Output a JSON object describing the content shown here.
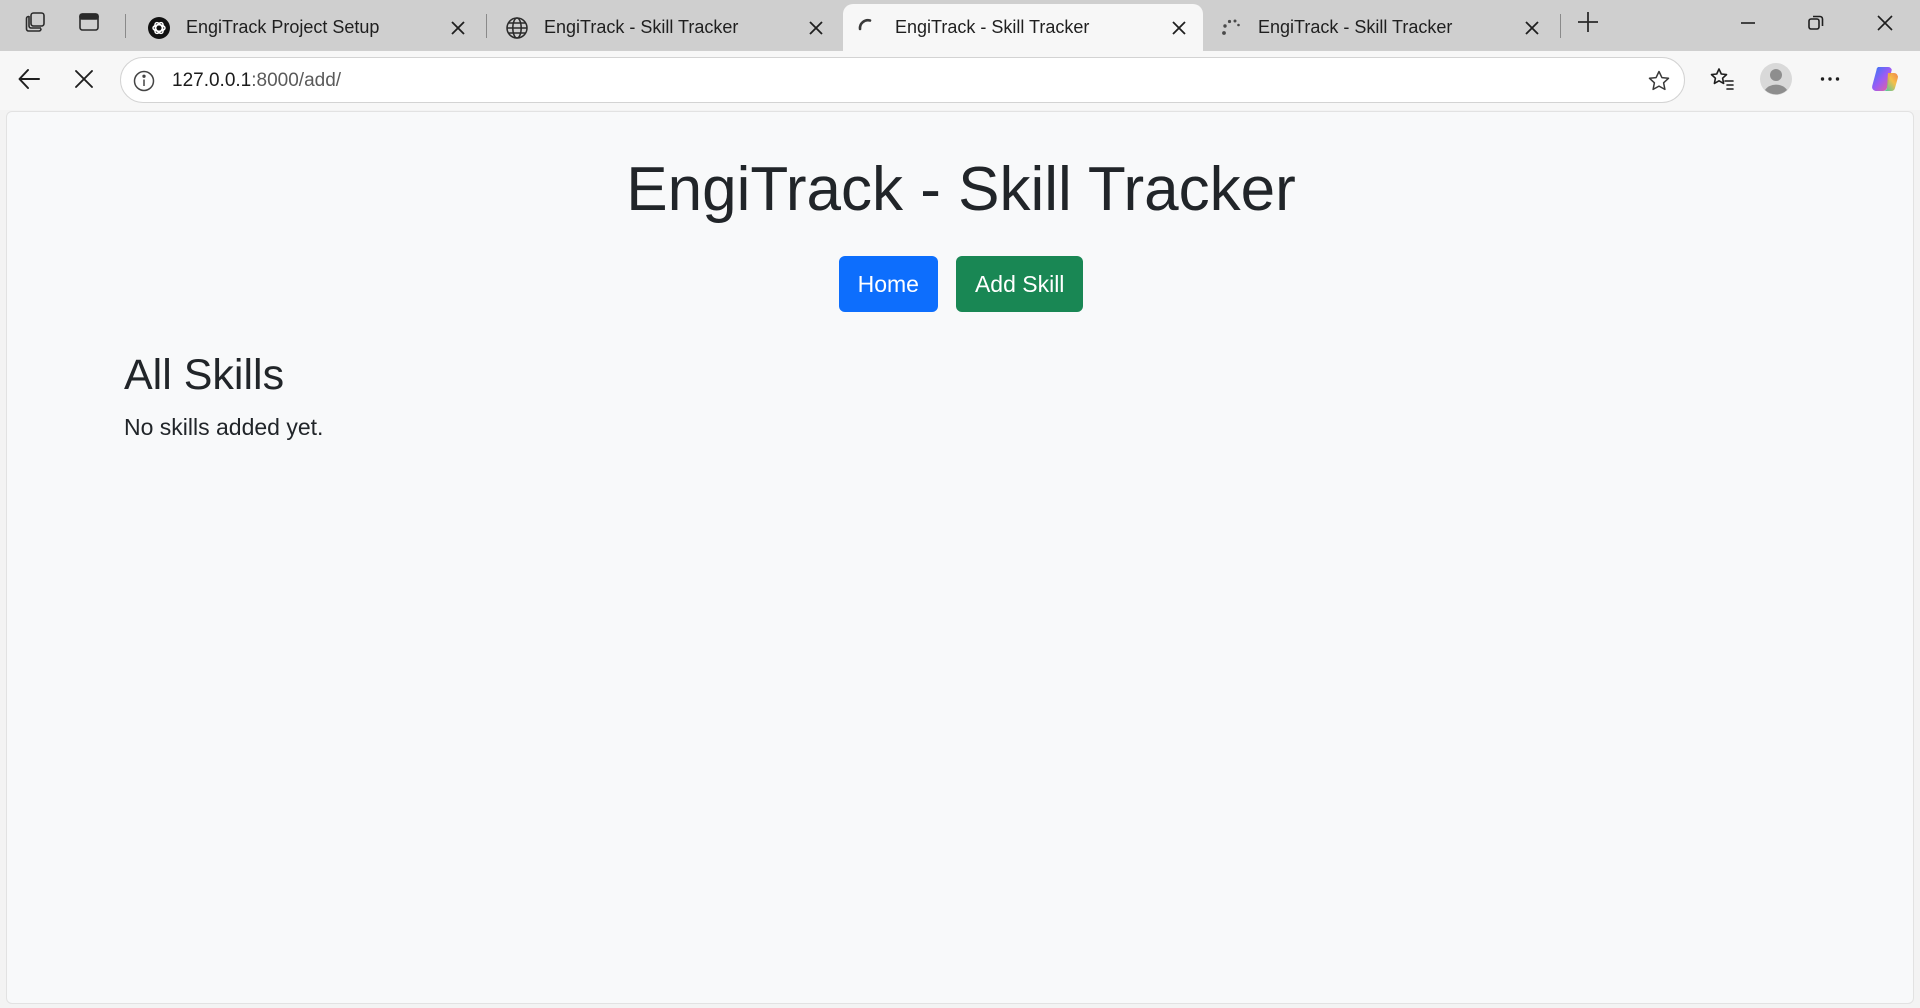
{
  "browser": {
    "tabs": [
      {
        "title": "EngiTrack Project Setup",
        "favicon": "openai-logo-icon",
        "active": false
      },
      {
        "title": "EngiTrack - Skill Tracker",
        "favicon": "globe-icon",
        "active": false
      },
      {
        "title": "EngiTrack - Skill Tracker",
        "favicon": "loading-spinner-icon",
        "active": true
      },
      {
        "title": "EngiTrack - Skill Tracker",
        "favicon": "loading-dots-icon",
        "active": false
      }
    ],
    "address": {
      "host": "127.0.0.1",
      "rest": ":8000/add/"
    }
  },
  "page": {
    "title": "EngiTrack - Skill Tracker",
    "nav": {
      "home_label": "Home",
      "add_label": "Add Skill"
    },
    "section_title": "All Skills",
    "empty_message": "No skills added yet."
  },
  "colors": {
    "primary": "#0d6efd",
    "success": "#198754",
    "page_bg": "#f8f9fa",
    "text": "#212529"
  }
}
